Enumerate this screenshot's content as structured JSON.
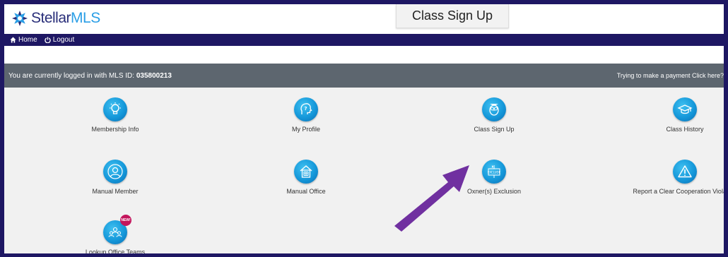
{
  "brand": {
    "name_part1": "Stellar",
    "name_part2": "MLS"
  },
  "nav": {
    "home": "Home",
    "logout": "Logout"
  },
  "callout": {
    "text": "Class Sign Up"
  },
  "info_bar": {
    "login_prefix": "You are currently logged in with MLS ID:",
    "mls_id": "035800213",
    "payment_link": "Trying to make a payment Click here?"
  },
  "tiles": [
    {
      "label": "Membership Info",
      "icon": "lightbulb-icon"
    },
    {
      "label": "My Profile",
      "icon": "question-head-icon"
    },
    {
      "label": "Class Sign Up",
      "icon": "owl-icon"
    },
    {
      "label": "Class History",
      "icon": "graduation-cap-icon"
    },
    {
      "label": "Manual Member",
      "icon": "person-icon"
    },
    {
      "label": "Manual Office",
      "icon": "building-icon"
    },
    {
      "label": "Oxner(s) Exclusion",
      "icon": "exclude-sign-icon",
      "icon_text": "EXCLUDE"
    },
    {
      "label": "Report a Clear Cooperation Violation",
      "icon": "warning-icon"
    },
    {
      "label": "Lookup Office Teams",
      "icon": "team-icon",
      "badge": "NEW!"
    }
  ],
  "colors": {
    "navy": "#1e1763",
    "info_bar": "#5d666f",
    "icon_blue": "#1598da",
    "arrow_purple": "#7030a0",
    "badge": "#c3155c"
  }
}
